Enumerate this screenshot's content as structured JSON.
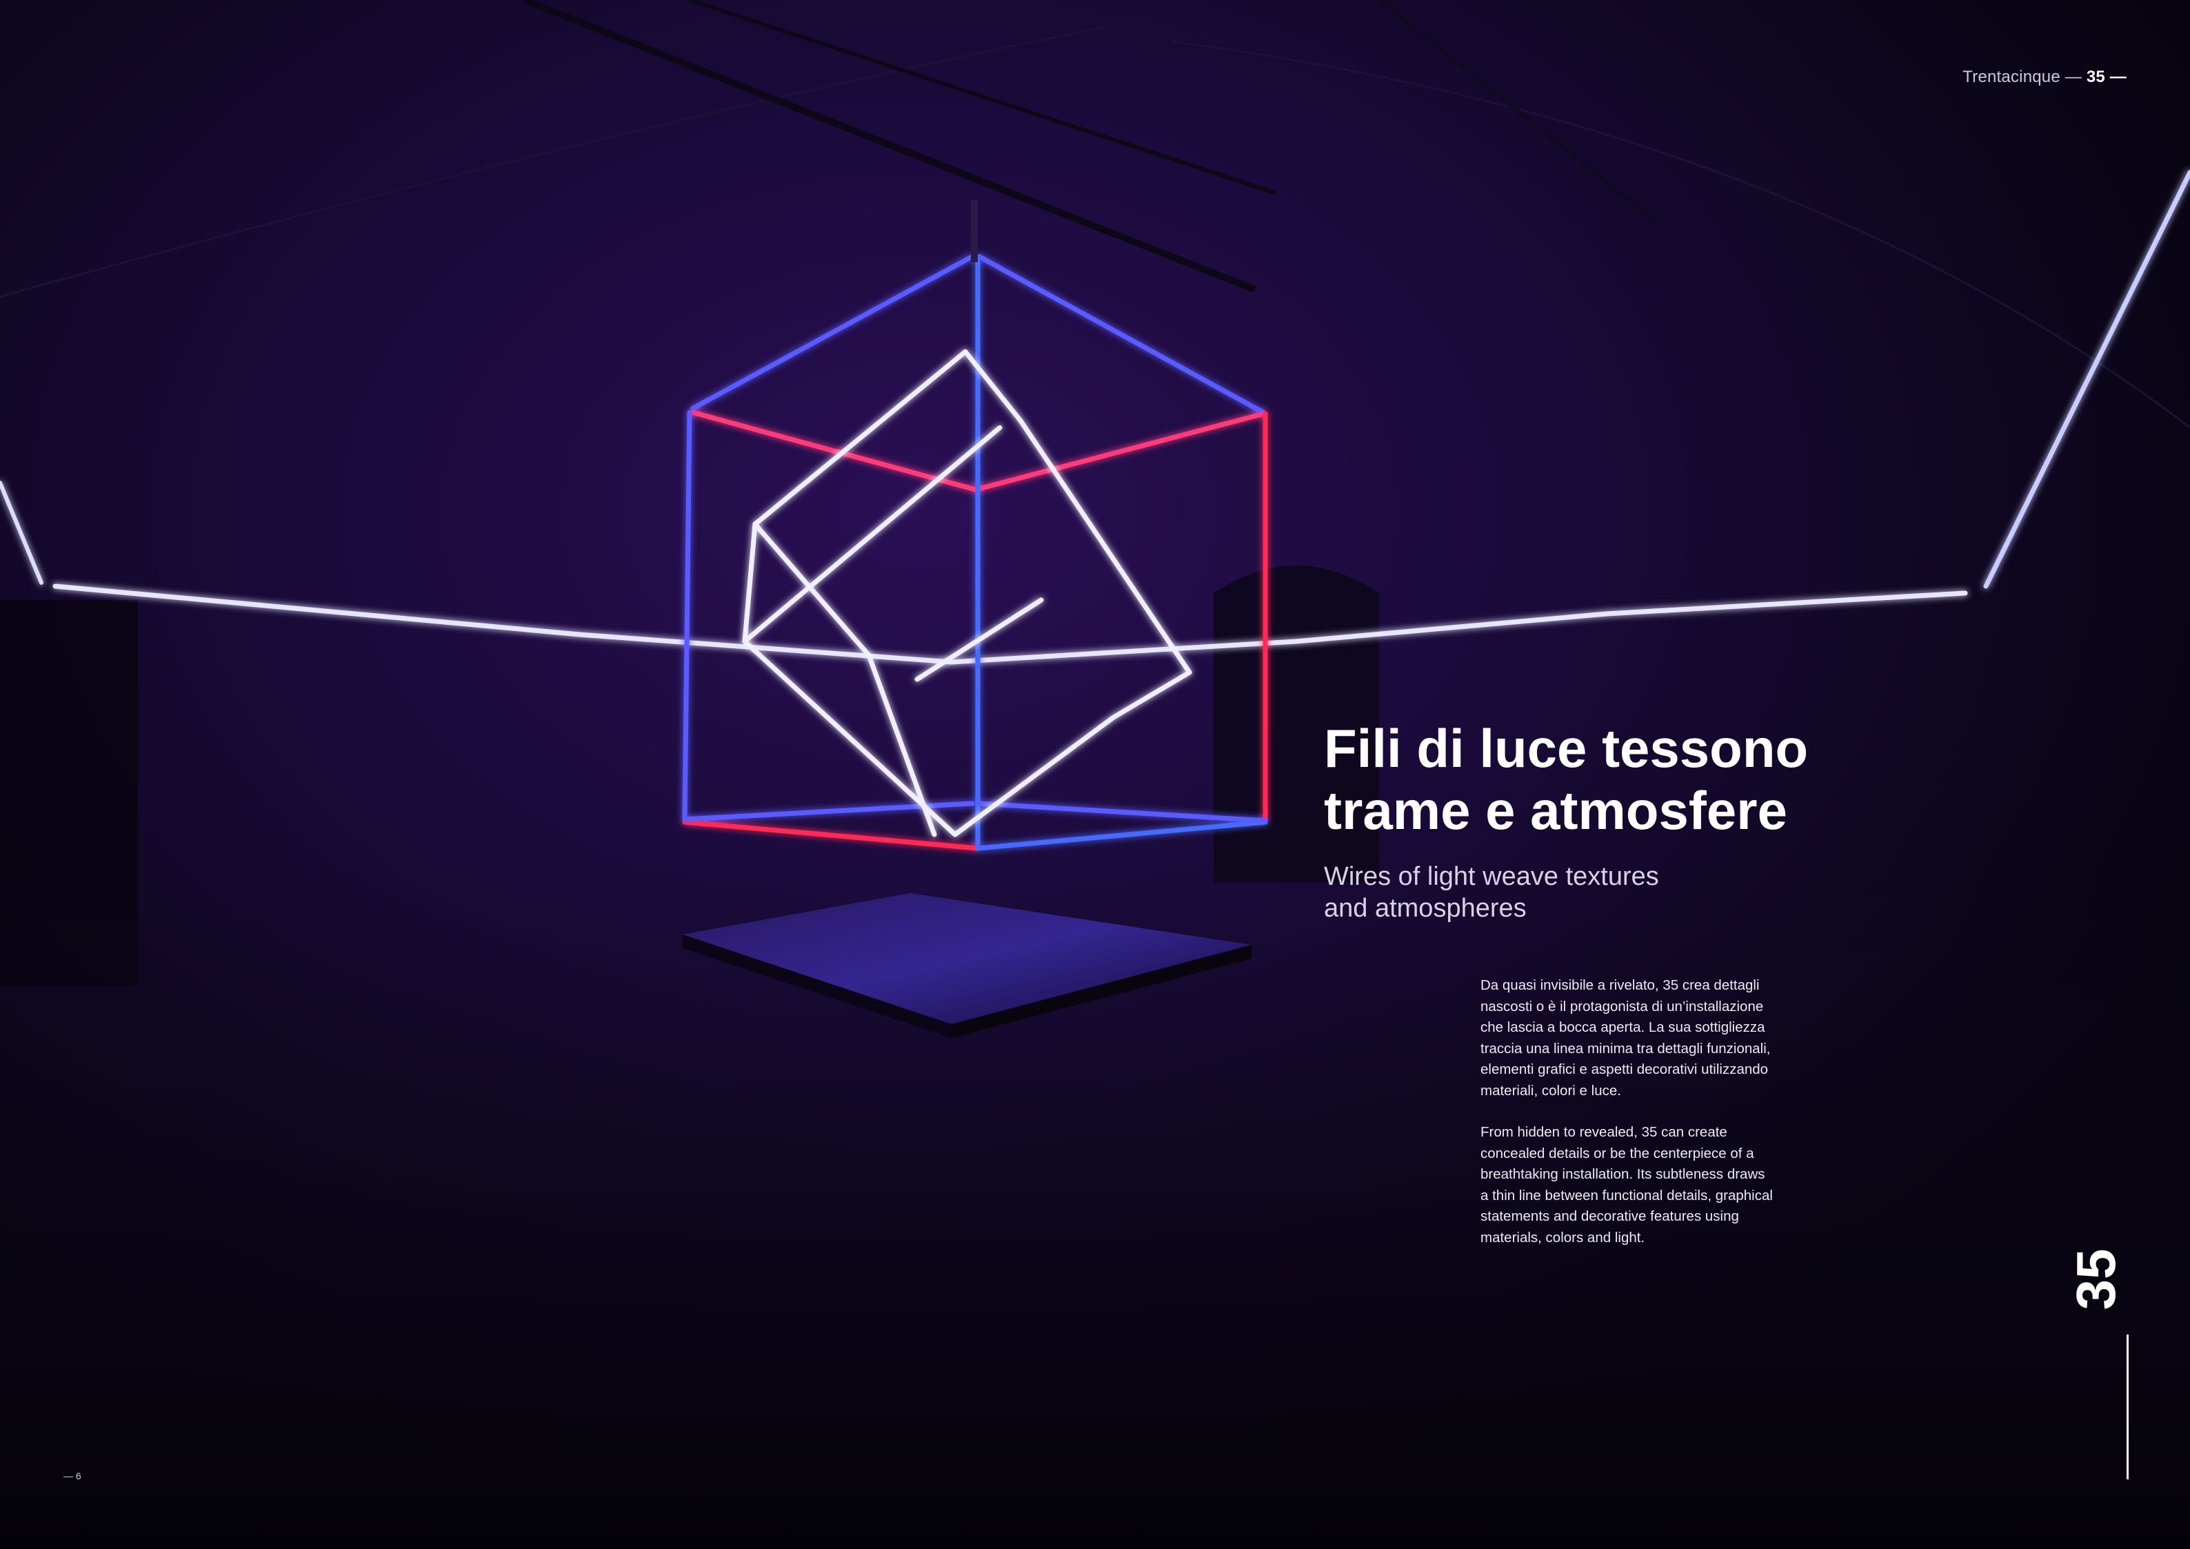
{
  "header": {
    "prefix": "Trentacinque — ",
    "number": "35 —"
  },
  "title": {
    "line1": "Fili di luce tessono",
    "line2": "trame e atmosfere"
  },
  "subtitle": {
    "line1": "Wires of light weave textures",
    "line2": "and atmospheres"
  },
  "body_it": [
    "Da quasi invisibile a rivelato, 35 crea dettagli",
    "nascosti o è il protagonista di un’installazione",
    "che lascia a bocca aperta. La sua sottigliezza",
    "traccia una linea minima tra dettagli funzionali,",
    "elementi grafici e aspetti decorativi utilizzando",
    "materiali, colori e luce."
  ],
  "body_en": [
    "From hidden to revealed, 35 can create",
    "concealed details or be the centerpiece of a",
    "breathtaking installation. Its subtleness draws",
    "a thin line between functional details, graphical",
    "statements and decorative features using",
    "materials, colors and light."
  ],
  "page_number": "— 6",
  "vertical_brand": "35",
  "colors": {
    "background": "#0a0614",
    "room_violet": "#2a0f55",
    "led_blue": "#4a6bff",
    "led_red": "#ff2a55",
    "led_white": "#e8e6ff"
  },
  "icons": {
    "installation": "led-cube-installation-photo"
  }
}
